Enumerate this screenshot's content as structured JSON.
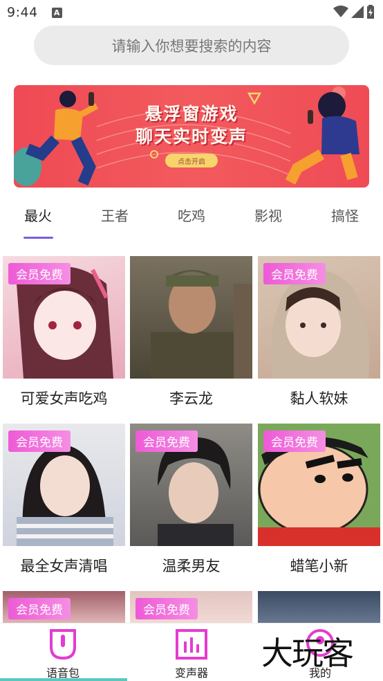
{
  "status_bar": {
    "time": "9:44",
    "notification_letter": "A"
  },
  "search": {
    "placeholder": "请输入你想要搜索的内容"
  },
  "banner": {
    "title_line1": "悬浮窗游戏",
    "title_line2": "聊天实时变声",
    "button_label": "点击开启"
  },
  "tabs": [
    {
      "label": "最火",
      "active": true
    },
    {
      "label": "王者",
      "active": false
    },
    {
      "label": "吃鸡",
      "active": false
    },
    {
      "label": "影视",
      "active": false
    },
    {
      "label": "搞怪",
      "active": false
    }
  ],
  "cards": [
    {
      "title": "可爱女声吃鸡",
      "badge": "会员免费"
    },
    {
      "title": "李云龙",
      "badge": ""
    },
    {
      "title": "黏人软妹",
      "badge": "会员免费"
    },
    {
      "title": "最全女声清唱",
      "badge": "会员免费"
    },
    {
      "title": "温柔男友",
      "badge": "会员免费"
    },
    {
      "title": "蜡笔小新",
      "badge": "会员免费"
    },
    {
      "title": "",
      "badge": "会员免费"
    },
    {
      "title": "",
      "badge": "会员免费"
    },
    {
      "title": "",
      "badge": ""
    }
  ],
  "bottom_nav": [
    {
      "label": "语音包",
      "icon": "voice-pack-icon"
    },
    {
      "label": "变声器",
      "icon": "voice-changer-icon"
    },
    {
      "label": "我的",
      "icon": "profile-icon"
    }
  ],
  "watermark": "大玩客",
  "colors": {
    "accent": "#7b5ce0",
    "badge": "#ee5ad6",
    "nav_icon": "#e43bd0",
    "banner": "#ef4a55"
  }
}
